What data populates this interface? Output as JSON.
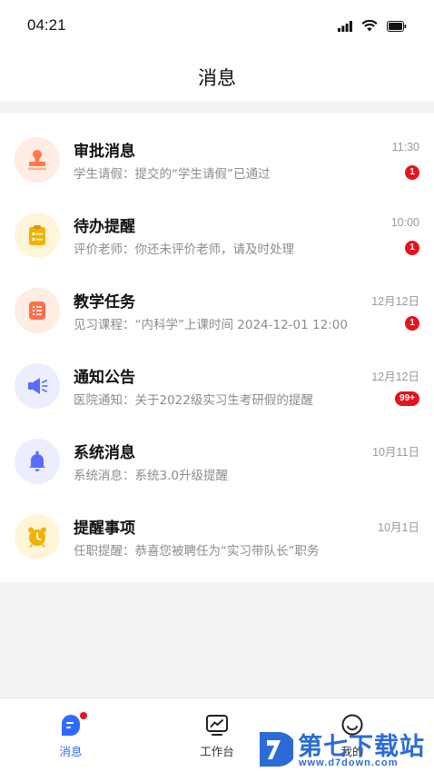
{
  "status_bar": {
    "time": "04:21"
  },
  "nav": {
    "title": "消息"
  },
  "messages": [
    {
      "title": "审批消息",
      "subtitle": "学生请假：提交的“学生请假”已通过",
      "time": "11:30",
      "badge": "1",
      "icon": "stamp-icon",
      "color": "#ff7a45",
      "bg": "#ffece3"
    },
    {
      "title": "待办提醒",
      "subtitle": "评价老师：你还未评价老师，请及时处理",
      "time": "10:00",
      "badge": "1",
      "icon": "clipboard-icon",
      "color": "#f5b000",
      "bg": "#fff6d9"
    },
    {
      "title": "教学任务",
      "subtitle": "见习课程：“内科学”上课时间 2024-12-01 12:00",
      "time": "12月12日",
      "badge": "1",
      "icon": "list-icon",
      "color": "#ff6f4a",
      "bg": "#ffece3"
    },
    {
      "title": "通知公告",
      "subtitle": "医院通知：关于2022级实习生考研假的提醒",
      "time": "12月12日",
      "badge": "99+",
      "icon": "megaphone-icon",
      "color": "#5b6cff",
      "bg": "#eceeff"
    },
    {
      "title": "系统消息",
      "subtitle": "系统消息：系统3.0升级提醒",
      "time": "10月11日",
      "badge": "",
      "icon": "bell-icon",
      "color": "#5b6cff",
      "bg": "#eceeff"
    },
    {
      "title": "提醒事项",
      "subtitle": "任职提醒：恭喜您被聘任为“实习带队长”职务",
      "time": "10月1日",
      "badge": "",
      "icon": "alarm-clock-icon",
      "color": "#f5b000",
      "bg": "#fff6d9"
    }
  ],
  "tabbar": {
    "tabs": [
      {
        "label": "消息",
        "icon": "message-icon",
        "active": true
      },
      {
        "label": "工作台",
        "icon": "workbench-icon",
        "active": false
      },
      {
        "label": "我的",
        "icon": "smiley-icon",
        "active": false
      }
    ]
  },
  "watermark": {
    "brand_cn": "第七下载站",
    "brand_en": "www.d7down.com"
  },
  "colors": {
    "accent": "#2f6bff",
    "badge": "#e5141c"
  }
}
